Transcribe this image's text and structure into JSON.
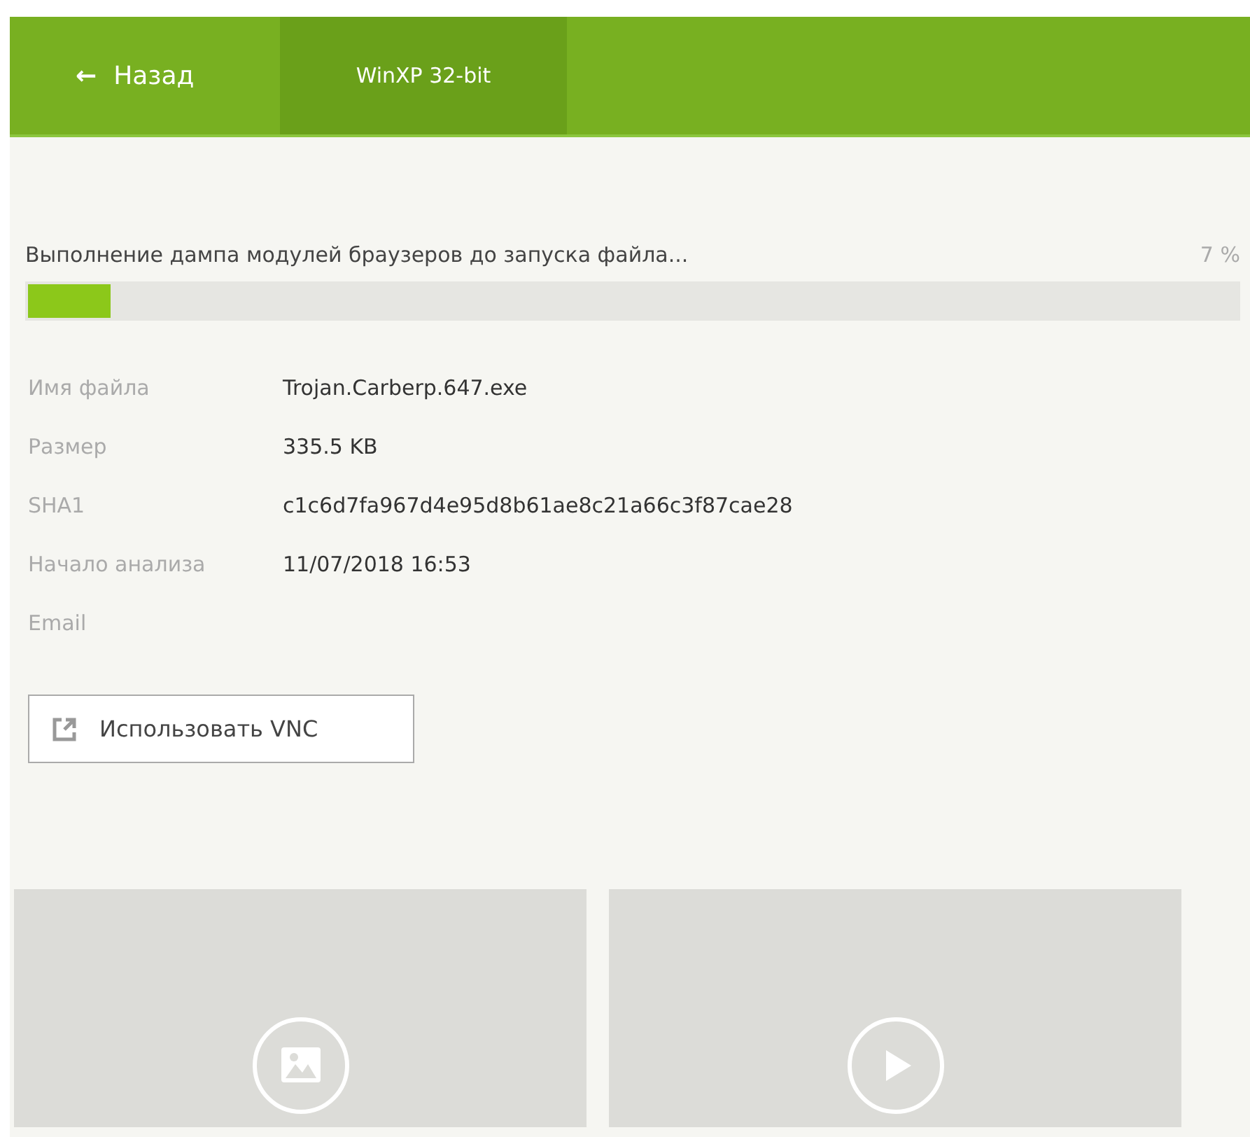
{
  "header": {
    "back": {
      "icon": "←",
      "label": "Назад"
    },
    "tabs": [
      {
        "label": "WinXP 32-bit",
        "selected": true
      }
    ]
  },
  "progress": {
    "message": "Выполнение дампа модулей браузеров до запуска файла...",
    "percent": "7 %",
    "level": 0.07
  },
  "details": [
    {
      "label": "Имя файла",
      "value": "Trojan.Carberp.647.exe"
    },
    {
      "label": "Размер",
      "value": "335.5 KB"
    },
    {
      "label": "SHA1",
      "value": "c1c6d7fa967d4e95d8b61ae8c21a66c3f87cae28"
    },
    {
      "label": "Начало анализа",
      "value": "11/07/2018 16:53"
    },
    {
      "label": "Email"
    }
  ],
  "vnc_button": {
    "label": "Использовать VNC"
  },
  "previews": [
    {
      "kind": "image"
    },
    {
      "kind": "video"
    }
  ]
}
